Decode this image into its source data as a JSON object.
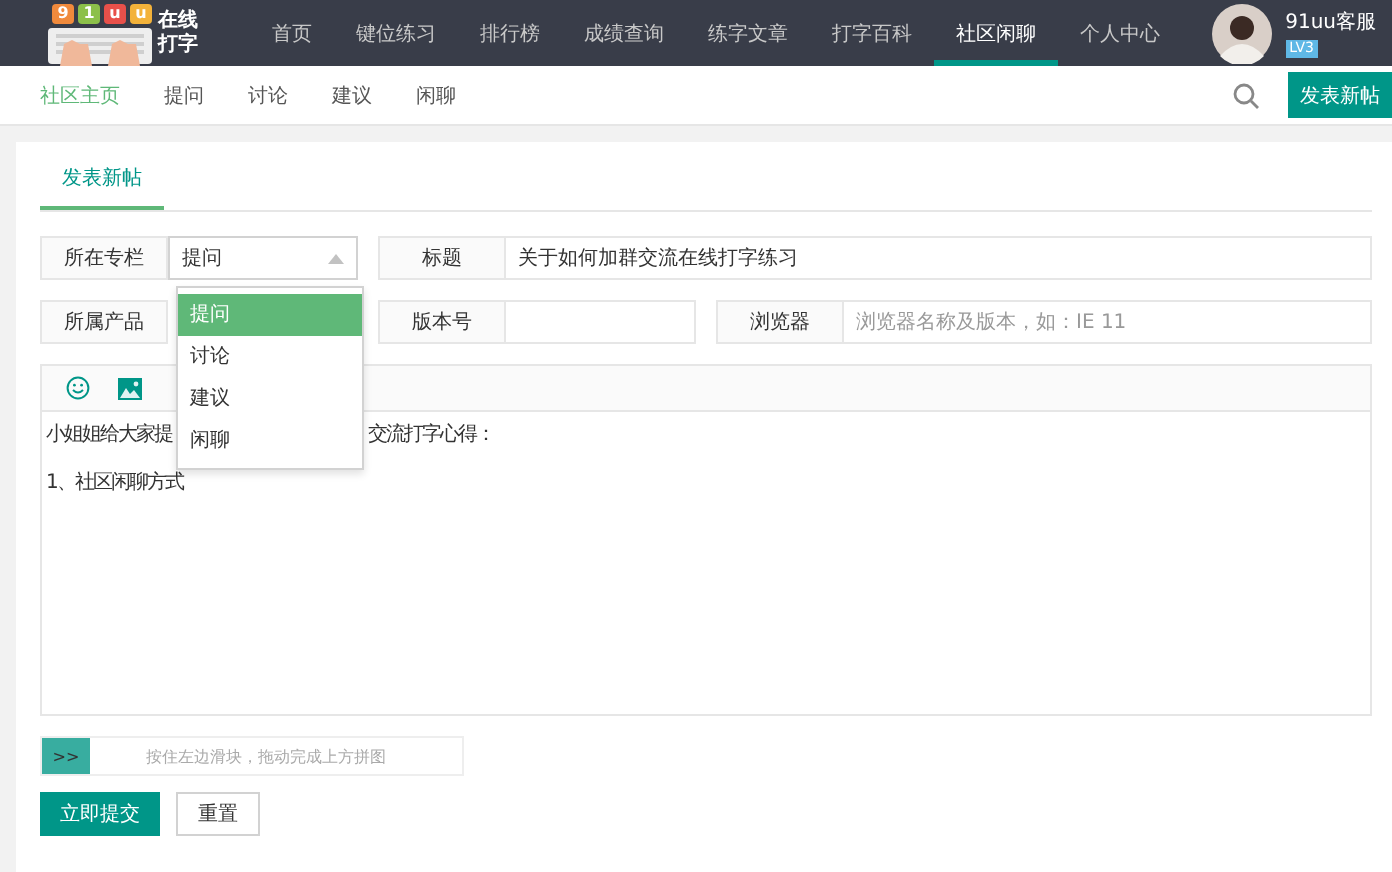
{
  "logo": {
    "keys": [
      {
        "label": "9",
        "color": "#f08a3c"
      },
      {
        "label": "1",
        "color": "#8cc04a"
      },
      {
        "label": "u",
        "color": "#e8504a"
      },
      {
        "label": "u",
        "color": "#f3b23a"
      }
    ],
    "text": "在线打字"
  },
  "nav": [
    {
      "label": "首页",
      "selected": false
    },
    {
      "label": "键位练习",
      "selected": false
    },
    {
      "label": "排行榜",
      "selected": false
    },
    {
      "label": "成绩查询",
      "selected": false
    },
    {
      "label": "练字文章",
      "selected": false
    },
    {
      "label": "打字百科",
      "selected": false
    },
    {
      "label": "社区闲聊",
      "selected": true
    },
    {
      "label": "个人中心",
      "selected": false
    }
  ],
  "user": {
    "name": "91uu客服",
    "level": "LV3"
  },
  "subnav": [
    {
      "label": "社区主页",
      "selected": true
    },
    {
      "label": "提问",
      "selected": false
    },
    {
      "label": "讨论",
      "selected": false
    },
    {
      "label": "建议",
      "selected": false
    },
    {
      "label": "闲聊",
      "selected": false
    }
  ],
  "new_post_button": "发表新帖",
  "form_tab": "发表新帖",
  "column": {
    "label": "所在专栏",
    "value": "提问",
    "options": [
      {
        "label": "提问",
        "selected": true
      },
      {
        "label": "讨论",
        "selected": false
      },
      {
        "label": "建议",
        "selected": false
      },
      {
        "label": "闲聊",
        "selected": false
      }
    ]
  },
  "title": {
    "label": "标题",
    "value": "关于如何加群交流在线打字练习"
  },
  "product": {
    "label": "所属产品"
  },
  "version": {
    "label": "版本号"
  },
  "browser": {
    "label": "浏览器",
    "placeholder": "浏览器名称及版本，如：IE 11"
  },
  "editor": {
    "line_1_start": "小姐姐给大家提",
    "line_1_end": "交流打字心得：",
    "line_2": "1、社区闲聊方式"
  },
  "slider": {
    "level": 0,
    "handle": ">>",
    "hint": "按住左边滑块，拖动完成上方拼图"
  },
  "buttons": [
    {
      "label": "立即提交",
      "kind": "primary"
    },
    {
      "label": "重置",
      "kind": "plain"
    }
  ]
}
